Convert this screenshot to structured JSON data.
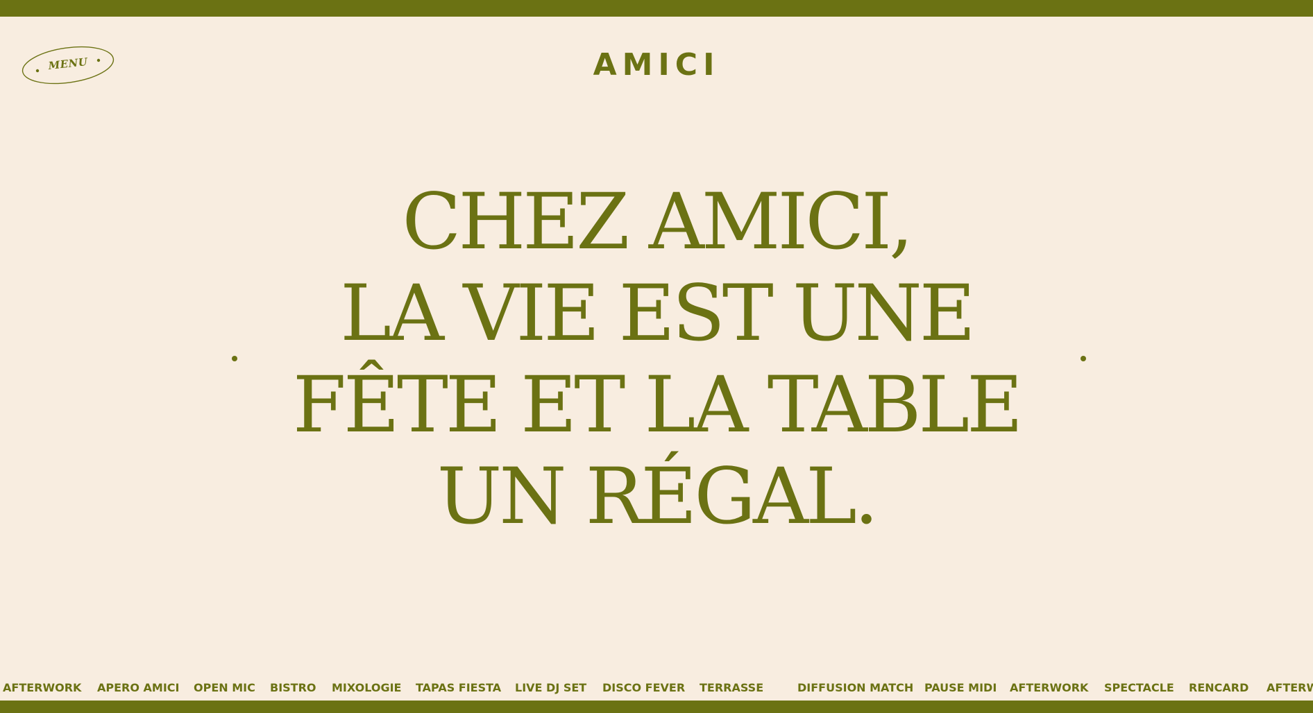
{
  "brand": {
    "logo": "AMICI",
    "color": "#6b7213",
    "background": "#f8ede0"
  },
  "menu": {
    "label": "MENU"
  },
  "hero": {
    "lines": [
      "CHEZ AMICI,",
      "LA VIE EST UNE",
      "FÊTE ET LA TABLE",
      "UN RÉGAL."
    ]
  },
  "ticker": {
    "items": [
      "AFTERWORK",
      "APERO AMICI",
      "OPEN MIC",
      "BISTRO",
      "MIXOLOGIE",
      "TAPAS FIESTA",
      "LIVE DJ SET",
      "DISCO FEVER",
      "TERRASSE",
      "DIFFUSION MATCH",
      "PAUSE MIDI",
      "AFTERWORK",
      "SPECTACLE",
      "RENCARD",
      "AFTERWORK"
    ]
  }
}
